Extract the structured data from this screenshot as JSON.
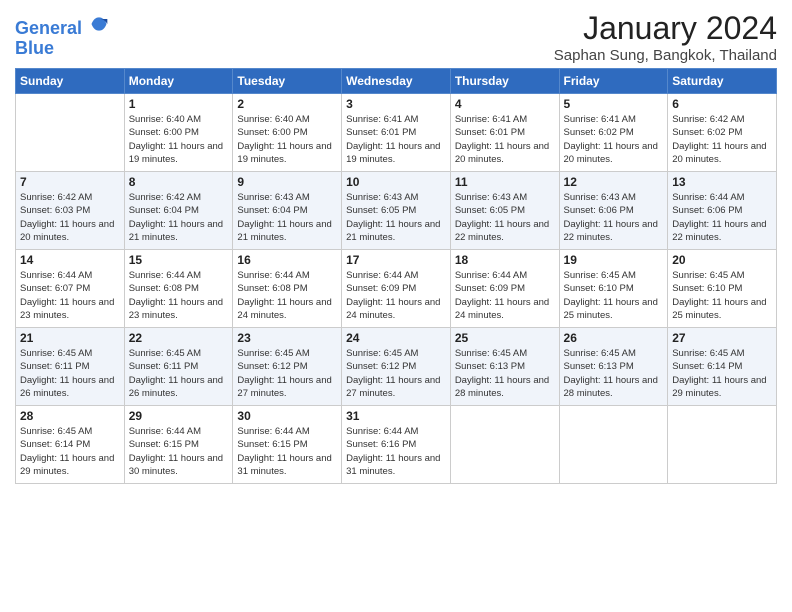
{
  "header": {
    "logo_line1": "General",
    "logo_line2": "Blue",
    "month": "January 2024",
    "location": "Saphan Sung, Bangkok, Thailand"
  },
  "weekdays": [
    "Sunday",
    "Monday",
    "Tuesday",
    "Wednesday",
    "Thursday",
    "Friday",
    "Saturday"
  ],
  "weeks": [
    [
      {
        "day": "",
        "sunrise": "",
        "sunset": "",
        "daylight": ""
      },
      {
        "day": "1",
        "sunrise": "Sunrise: 6:40 AM",
        "sunset": "Sunset: 6:00 PM",
        "daylight": "Daylight: 11 hours and 19 minutes."
      },
      {
        "day": "2",
        "sunrise": "Sunrise: 6:40 AM",
        "sunset": "Sunset: 6:00 PM",
        "daylight": "Daylight: 11 hours and 19 minutes."
      },
      {
        "day": "3",
        "sunrise": "Sunrise: 6:41 AM",
        "sunset": "Sunset: 6:01 PM",
        "daylight": "Daylight: 11 hours and 19 minutes."
      },
      {
        "day": "4",
        "sunrise": "Sunrise: 6:41 AM",
        "sunset": "Sunset: 6:01 PM",
        "daylight": "Daylight: 11 hours and 20 minutes."
      },
      {
        "day": "5",
        "sunrise": "Sunrise: 6:41 AM",
        "sunset": "Sunset: 6:02 PM",
        "daylight": "Daylight: 11 hours and 20 minutes."
      },
      {
        "day": "6",
        "sunrise": "Sunrise: 6:42 AM",
        "sunset": "Sunset: 6:02 PM",
        "daylight": "Daylight: 11 hours and 20 minutes."
      }
    ],
    [
      {
        "day": "7",
        "sunrise": "Sunrise: 6:42 AM",
        "sunset": "Sunset: 6:03 PM",
        "daylight": "Daylight: 11 hours and 20 minutes."
      },
      {
        "day": "8",
        "sunrise": "Sunrise: 6:42 AM",
        "sunset": "Sunset: 6:04 PM",
        "daylight": "Daylight: 11 hours and 21 minutes."
      },
      {
        "day": "9",
        "sunrise": "Sunrise: 6:43 AM",
        "sunset": "Sunset: 6:04 PM",
        "daylight": "Daylight: 11 hours and 21 minutes."
      },
      {
        "day": "10",
        "sunrise": "Sunrise: 6:43 AM",
        "sunset": "Sunset: 6:05 PM",
        "daylight": "Daylight: 11 hours and 21 minutes."
      },
      {
        "day": "11",
        "sunrise": "Sunrise: 6:43 AM",
        "sunset": "Sunset: 6:05 PM",
        "daylight": "Daylight: 11 hours and 22 minutes."
      },
      {
        "day": "12",
        "sunrise": "Sunrise: 6:43 AM",
        "sunset": "Sunset: 6:06 PM",
        "daylight": "Daylight: 11 hours and 22 minutes."
      },
      {
        "day": "13",
        "sunrise": "Sunrise: 6:44 AM",
        "sunset": "Sunset: 6:06 PM",
        "daylight": "Daylight: 11 hours and 22 minutes."
      }
    ],
    [
      {
        "day": "14",
        "sunrise": "Sunrise: 6:44 AM",
        "sunset": "Sunset: 6:07 PM",
        "daylight": "Daylight: 11 hours and 23 minutes."
      },
      {
        "day": "15",
        "sunrise": "Sunrise: 6:44 AM",
        "sunset": "Sunset: 6:08 PM",
        "daylight": "Daylight: 11 hours and 23 minutes."
      },
      {
        "day": "16",
        "sunrise": "Sunrise: 6:44 AM",
        "sunset": "Sunset: 6:08 PM",
        "daylight": "Daylight: 11 hours and 24 minutes."
      },
      {
        "day": "17",
        "sunrise": "Sunrise: 6:44 AM",
        "sunset": "Sunset: 6:09 PM",
        "daylight": "Daylight: 11 hours and 24 minutes."
      },
      {
        "day": "18",
        "sunrise": "Sunrise: 6:44 AM",
        "sunset": "Sunset: 6:09 PM",
        "daylight": "Daylight: 11 hours and 24 minutes."
      },
      {
        "day": "19",
        "sunrise": "Sunrise: 6:45 AM",
        "sunset": "Sunset: 6:10 PM",
        "daylight": "Daylight: 11 hours and 25 minutes."
      },
      {
        "day": "20",
        "sunrise": "Sunrise: 6:45 AM",
        "sunset": "Sunset: 6:10 PM",
        "daylight": "Daylight: 11 hours and 25 minutes."
      }
    ],
    [
      {
        "day": "21",
        "sunrise": "Sunrise: 6:45 AM",
        "sunset": "Sunset: 6:11 PM",
        "daylight": "Daylight: 11 hours and 26 minutes."
      },
      {
        "day": "22",
        "sunrise": "Sunrise: 6:45 AM",
        "sunset": "Sunset: 6:11 PM",
        "daylight": "Daylight: 11 hours and 26 minutes."
      },
      {
        "day": "23",
        "sunrise": "Sunrise: 6:45 AM",
        "sunset": "Sunset: 6:12 PM",
        "daylight": "Daylight: 11 hours and 27 minutes."
      },
      {
        "day": "24",
        "sunrise": "Sunrise: 6:45 AM",
        "sunset": "Sunset: 6:12 PM",
        "daylight": "Daylight: 11 hours and 27 minutes."
      },
      {
        "day": "25",
        "sunrise": "Sunrise: 6:45 AM",
        "sunset": "Sunset: 6:13 PM",
        "daylight": "Daylight: 11 hours and 28 minutes."
      },
      {
        "day": "26",
        "sunrise": "Sunrise: 6:45 AM",
        "sunset": "Sunset: 6:13 PM",
        "daylight": "Daylight: 11 hours and 28 minutes."
      },
      {
        "day": "27",
        "sunrise": "Sunrise: 6:45 AM",
        "sunset": "Sunset: 6:14 PM",
        "daylight": "Daylight: 11 hours and 29 minutes."
      }
    ],
    [
      {
        "day": "28",
        "sunrise": "Sunrise: 6:45 AM",
        "sunset": "Sunset: 6:14 PM",
        "daylight": "Daylight: 11 hours and 29 minutes."
      },
      {
        "day": "29",
        "sunrise": "Sunrise: 6:44 AM",
        "sunset": "Sunset: 6:15 PM",
        "daylight": "Daylight: 11 hours and 30 minutes."
      },
      {
        "day": "30",
        "sunrise": "Sunrise: 6:44 AM",
        "sunset": "Sunset: 6:15 PM",
        "daylight": "Daylight: 11 hours and 31 minutes."
      },
      {
        "day": "31",
        "sunrise": "Sunrise: 6:44 AM",
        "sunset": "Sunset: 6:16 PM",
        "daylight": "Daylight: 11 hours and 31 minutes."
      },
      {
        "day": "",
        "sunrise": "",
        "sunset": "",
        "daylight": ""
      },
      {
        "day": "",
        "sunrise": "",
        "sunset": "",
        "daylight": ""
      },
      {
        "day": "",
        "sunrise": "",
        "sunset": "",
        "daylight": ""
      }
    ]
  ]
}
